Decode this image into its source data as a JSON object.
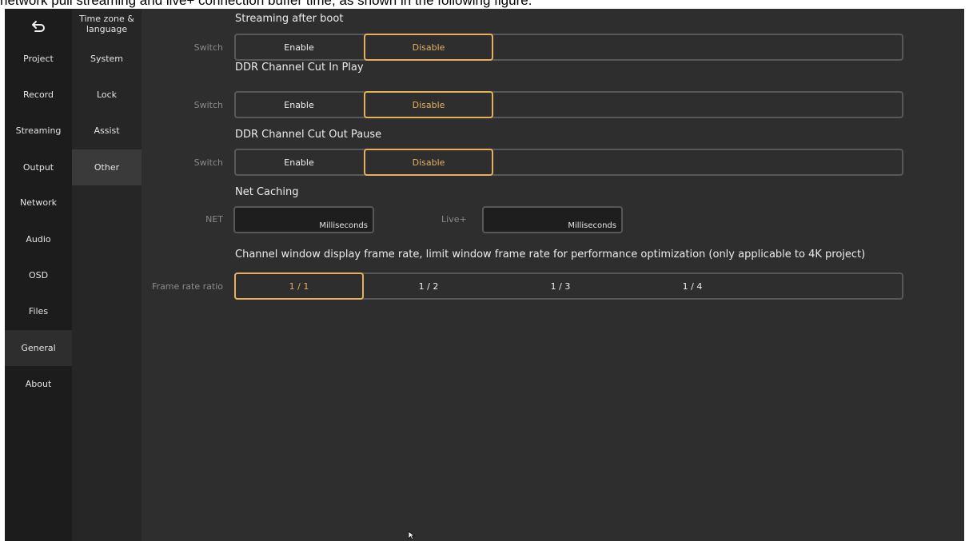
{
  "doc_caption": "network pull streaming and live+ connection buffer time, as shown in the following figure.",
  "nav_primary": [
    {
      "label": "Project"
    },
    {
      "label": "Record"
    },
    {
      "label": "Streaming"
    },
    {
      "label": "Output"
    },
    {
      "label": "Network"
    },
    {
      "label": "Audio"
    },
    {
      "label": "OSD"
    },
    {
      "label": "Files"
    },
    {
      "label": "General",
      "active": true
    },
    {
      "label": "About"
    }
  ],
  "nav_secondary": [
    {
      "label": "Time zone & language"
    },
    {
      "label": "System"
    },
    {
      "label": "Lock"
    },
    {
      "label": "Assist"
    },
    {
      "label": "Other",
      "active": true
    }
  ],
  "settings": {
    "streaming_after_boot": {
      "title": "Streaming after boot",
      "label": "Switch",
      "options": [
        "Enable",
        "Disable"
      ],
      "selected": "Disable"
    },
    "ddr_cut_in_play": {
      "title": "DDR Channel Cut In Play",
      "label": "Switch",
      "options": [
        "Enable",
        "Disable"
      ],
      "selected": "Disable"
    },
    "ddr_cut_out_pause": {
      "title": "DDR Channel Cut Out Pause",
      "label": "Switch",
      "options": [
        "Enable",
        "Disable"
      ],
      "selected": "Disable"
    },
    "net_caching": {
      "title": "Net Caching",
      "net_label": "NET",
      "net_value": "",
      "live_label": "Live+",
      "live_value": "",
      "unit": "Milliseconds"
    },
    "frame_rate": {
      "title": "Channel window display frame rate, limit window frame rate for performance optimization (only applicable to 4K project)",
      "label": "Frame rate ratio",
      "options": [
        "1 / 1",
        "1 / 2",
        "1 / 3",
        "1 / 4"
      ],
      "selected": "1 / 1"
    }
  },
  "colors": {
    "accent": "#e3b15c",
    "background": "#2e2e2e",
    "sidebar": "#1c1c1c"
  }
}
